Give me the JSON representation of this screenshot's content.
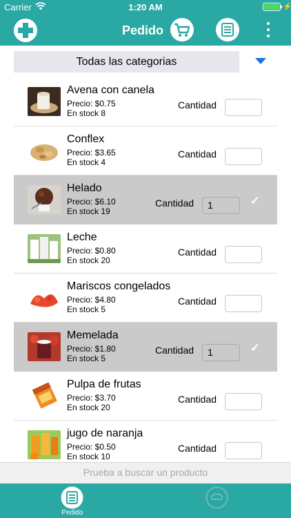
{
  "status_bar": {
    "carrier": "Carrier",
    "time": "1:20 AM",
    "battery_level": 1.0
  },
  "nav": {
    "title": "Pedido",
    "icons": [
      "plus-icon",
      "cart-icon",
      "list-icon",
      "more-vertical-icon"
    ]
  },
  "category": {
    "selected": "Todas las categorias"
  },
  "products": [
    {
      "name": "Avena con canela",
      "price": "Precio: $0.75",
      "stock": "En stock 8",
      "qty_label": "Cantidad",
      "qty": "",
      "selected": false,
      "thumb": "oats-drink"
    },
    {
      "name": "Conflex",
      "price": "Precio: $3.65",
      "stock": "En stock 4",
      "qty_label": "Cantidad",
      "qty": "",
      "selected": false,
      "thumb": "cereal"
    },
    {
      "name": "Helado",
      "price": "Precio: $6.10",
      "stock": "En stock 19",
      "qty_label": "Cantidad",
      "qty": "1",
      "selected": true,
      "thumb": "ice-cream"
    },
    {
      "name": "Leche",
      "price": "Precio: $0.80",
      "stock": "En stock 20",
      "qty_label": "Cantidad",
      "qty": "",
      "selected": false,
      "thumb": "milk"
    },
    {
      "name": "Mariscos congelados",
      "price": "Precio: $4.80",
      "stock": "En stock 5",
      "qty_label": "Cantidad",
      "qty": "",
      "selected": false,
      "thumb": "shrimp"
    },
    {
      "name": "Memelada",
      "price": "Precio: $1.80",
      "stock": "En stock 5",
      "qty_label": "Cantidad",
      "qty": "1",
      "selected": true,
      "thumb": "jam"
    },
    {
      "name": "Pulpa de frutas",
      "price": "Precio: $3.70",
      "stock": "En stock 20",
      "qty_label": "Cantidad",
      "qty": "",
      "selected": false,
      "thumb": "fruit-pulp"
    },
    {
      "name": "jugo de naranja",
      "price": "Precio: $0.50",
      "stock": "En stock 10",
      "qty_label": "Cantidad",
      "qty": "",
      "selected": false,
      "thumb": "orange-juice"
    }
  ],
  "search": {
    "placeholder": "Prueba a buscar un producto"
  },
  "tabs": [
    {
      "label": "Pedido",
      "icon": "list-icon",
      "active": true
    },
    {
      "label": "",
      "icon": "history-icon",
      "active": false
    }
  ],
  "colors": {
    "accent": "#2aa8a4",
    "selected_row": "#cacaca",
    "dropdown": "#1a73e8",
    "battery": "#4cd964"
  }
}
